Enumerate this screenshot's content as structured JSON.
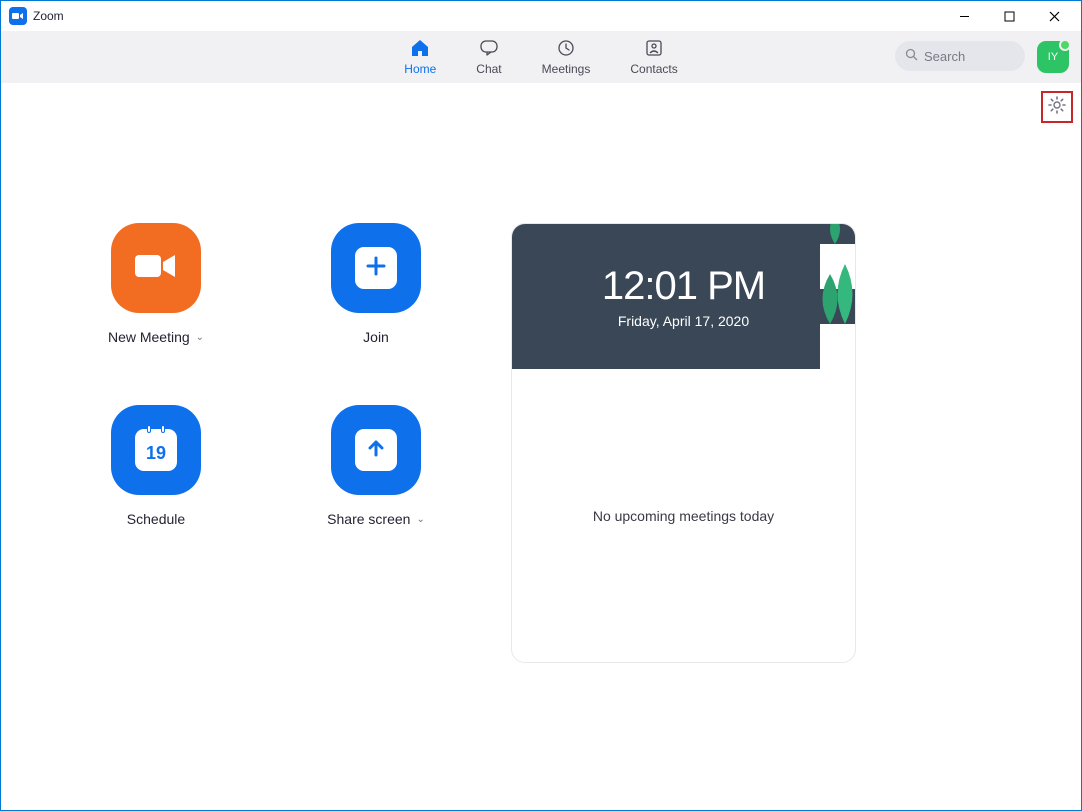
{
  "window": {
    "title": "Zoom"
  },
  "tabs": {
    "home": "Home",
    "chat": "Chat",
    "meetings": "Meetings",
    "contacts": "Contacts"
  },
  "search": {
    "placeholder": "Search"
  },
  "avatar": {
    "initials": "IY"
  },
  "actions": {
    "new_meeting": "New Meeting",
    "join": "Join",
    "schedule": "Schedule",
    "schedule_day": "19",
    "share_screen": "Share screen"
  },
  "calendar": {
    "time": "12:01 PM",
    "date": "Friday, April 17, 2020",
    "empty_text": "No upcoming meetings today"
  }
}
